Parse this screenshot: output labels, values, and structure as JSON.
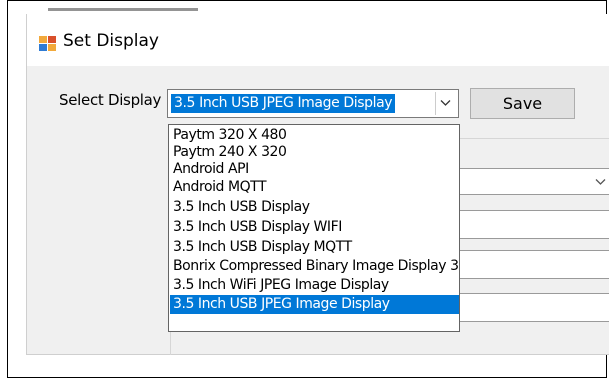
{
  "window": {
    "title": "Set Display"
  },
  "form": {
    "select_label": "Select Display",
    "selected_value": "3.5 Inch USB JPEG Image Display",
    "save_label": "Save"
  },
  "dropdown": {
    "options": [
      "Paytm 320 X 480",
      "Paytm 240 X 320",
      "Android API",
      "Android MQTT",
      "3.5 Inch USB Display",
      "3.5 Inch USB Display WIFI",
      "3.5 Inch USB Display MQTT",
      "Bonrix Compressed Binary Image Display 3",
      "3.5 Inch WiFi JPEG Image Display",
      "3.5 Inch USB JPEG Image Display"
    ],
    "selected_index": 9
  },
  "colors": {
    "selection": "#0078d7",
    "window_bg": "#f0f0f0"
  },
  "icons": {
    "app": "window-app-icon",
    "dropdown_arrow": "chevron-down-icon"
  }
}
